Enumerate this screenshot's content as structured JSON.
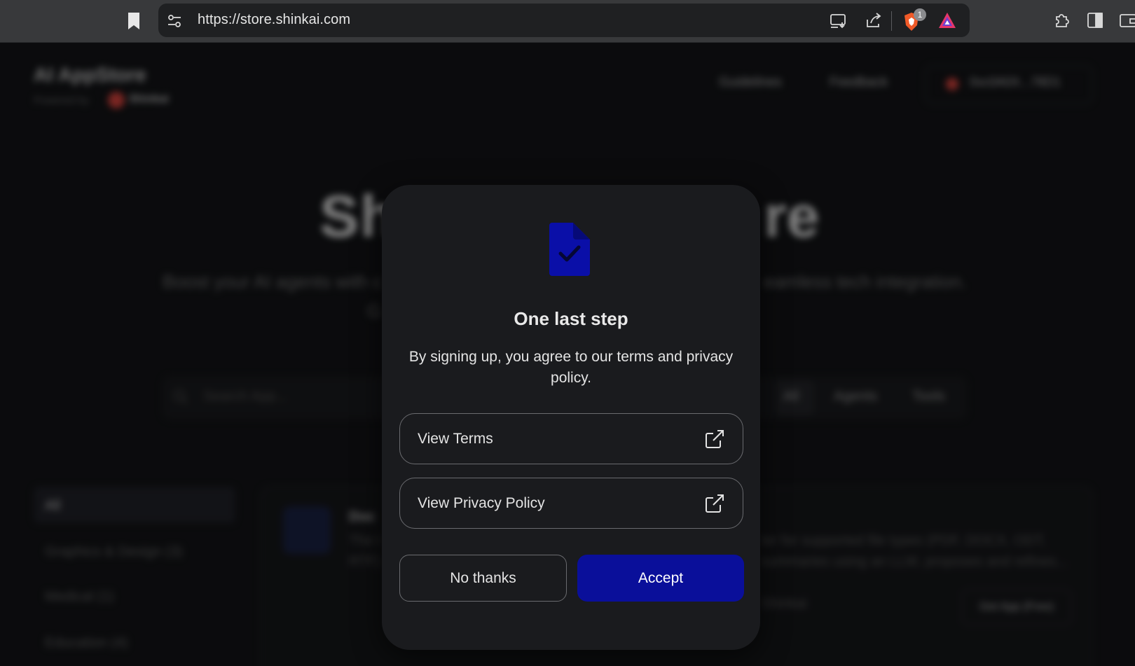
{
  "browser": {
    "url": "https://store.shinkai.com",
    "brave_badge": "1"
  },
  "background": {
    "brand": "AI AppStore",
    "powered_by": "Powered by",
    "shinkai": "Shinkai",
    "nav": [
      "Guidelines",
      "Feedback"
    ],
    "wallet": "0xc0A0X...78D1",
    "hero_left": "Sh",
    "hero_right": "re",
    "sub_left": "Boost your AI agents with c",
    "sub_right": "eamless tech integration.",
    "sub_line2": "G",
    "search_placeholder": "Search App...",
    "filters": [
      "All",
      "Agents",
      "Tools"
    ],
    "sidebar": [
      "All",
      "Graphics & Design (3)",
      "Medical (1)",
      "Education (4)"
    ],
    "card": {
      "title": "Doc",
      "line1_left": "The t",
      "line1_right": "ter for supported file types (PDF, DOCX, ODT,",
      "line2_left": "RTF)",
      "line2_right": "summaries using an LLM, proposes and refines...",
      "tag": "Shinkai",
      "get_label": "Get App (Free)"
    }
  },
  "modal": {
    "icon": "document-check-icon",
    "title": "One last step",
    "description": "By signing up, you agree to our terms and privacy policy.",
    "links": [
      {
        "label": "View Terms",
        "icon": "external-link-icon"
      },
      {
        "label": "View Privacy Policy",
        "icon": "external-link-icon"
      }
    ],
    "no_thanks": "No thanks",
    "accept": "Accept"
  },
  "colors": {
    "accent": "#0a0f9a",
    "icon_blue": "#0a0fa8",
    "modal_bg": "#1a1b1e"
  }
}
